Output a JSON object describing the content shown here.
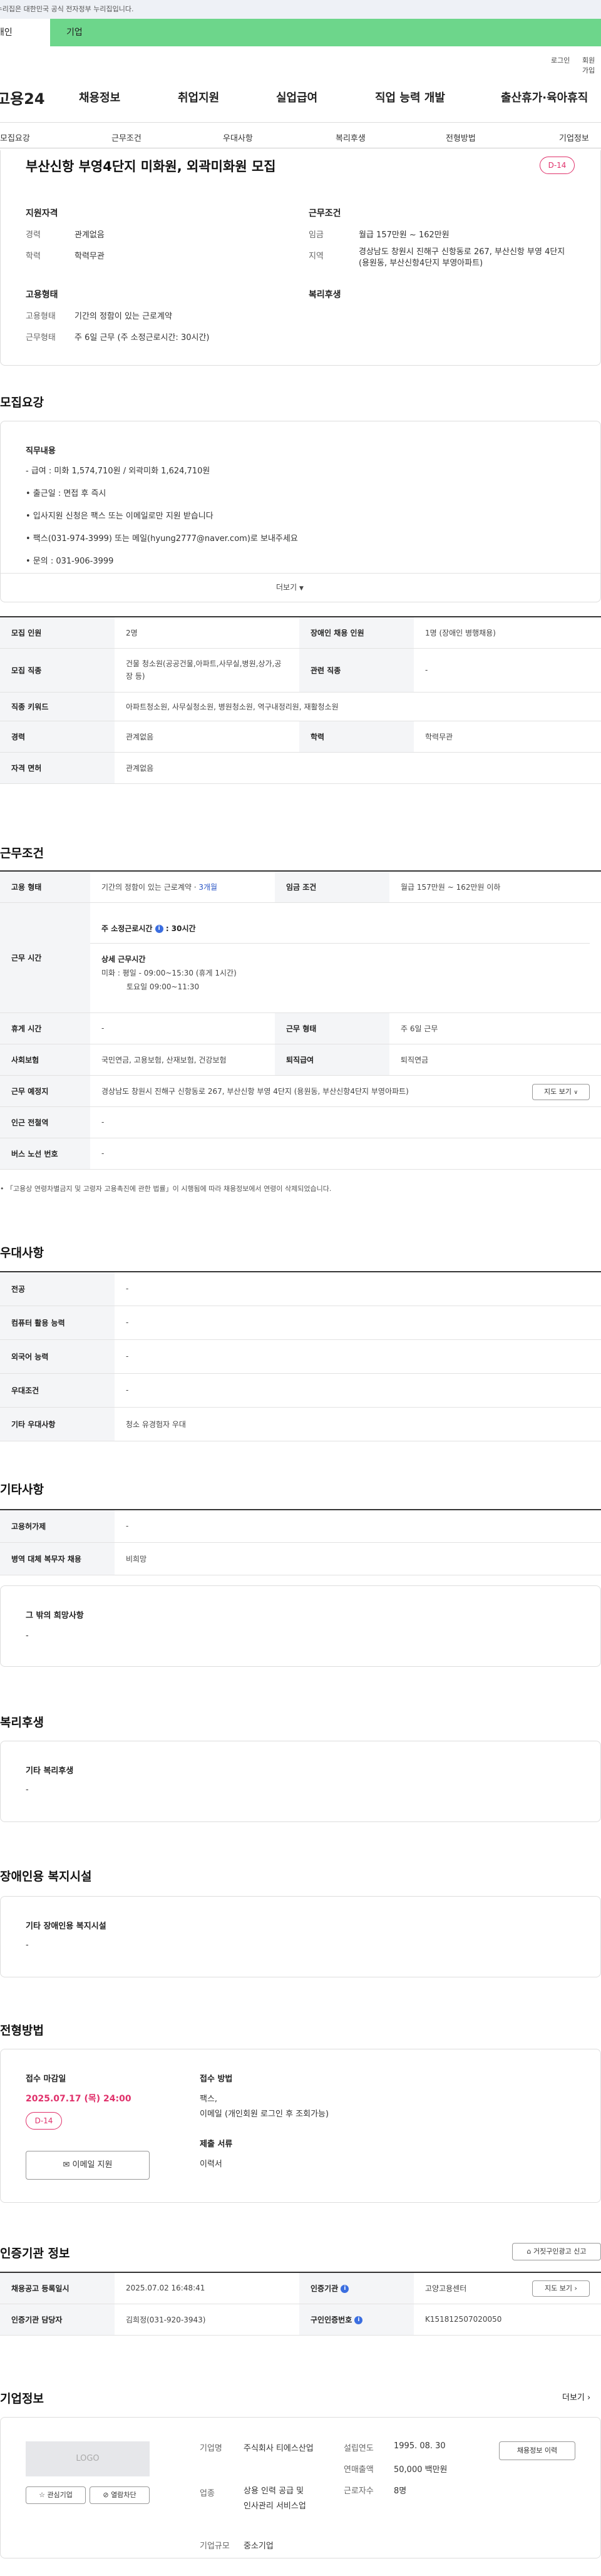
{
  "gov_banner": "이 누리집은 대한민국 공식 전자정부 누리집입니다.",
  "top_tabs": {
    "personal": "개인",
    "enterprise": "기업"
  },
  "util": {
    "login": "로그인",
    "join": "회원가입"
  },
  "logo": "고용24",
  "gnb": [
    "채용정보",
    "취업지원",
    "실업급여",
    "직업 능력 개발",
    "출산휴가·육아휴직"
  ],
  "subnav": [
    "모집요강",
    "근무조건",
    "우대사항",
    "복리후생",
    "전형방법",
    "기업정보"
  ],
  "summary": {
    "title": "부산신항 부영4단지 미화원, 외곽미화원 모집",
    "dday": "D-14",
    "qual_title": "지원자격",
    "career_label": "경력",
    "career": "관계없음",
    "edu_label": "학력",
    "edu": "학력무관",
    "cond_title": "근무조건",
    "wage_label": "임금",
    "wage": "월급 157만원 ~ 162만원",
    "area_label": "지역",
    "area": "경상남도 창원시 진해구 신항동로 267, 부산신항 부영 4단지 (용원동, 부산신항4단지 부영아파트)",
    "emp_title": "고용형태",
    "emptype_label": "고용형태",
    "emptype": "기간의 정함이 있는 근로계약",
    "worktype_label": "근무형태",
    "worktype": "주 6일 근무 (주 소정근로시간: 30시간)",
    "welfare_title": "복리후생"
  },
  "recruit": {
    "heading": "모집요강",
    "duty_title": "직무내용",
    "lines": [
      "- 급여 : 미화 1,574,710원 / 외곽미화 1,624,710원",
      "• 출근일 : 면접 후 즉시",
      "• 입사지원 신청은 팩스 또는 이메일로만 지원 받습니다",
      "• 팩스(031-974-3999) 또는 메일(hyung2777@naver.com)로 보내주세요",
      "• 문의 : 031-906-3999"
    ],
    "more": "더보기"
  },
  "recruit_table": {
    "count_label": "모집 인원",
    "count": "2명",
    "disabled_label": "장애인 채용 인원",
    "disabled": "1명 (장애인 병행채용)",
    "job_label": "모집 직종",
    "job": "건물 청소원(공공건물,아파트,사무실,병원,상가,공장 등)",
    "related_label": "관련 직종",
    "related": "-",
    "keyword_label": "직종 키워드",
    "keyword": "아파트청소원, 사무실청소원, 병원청소원, 역구내정리원, 재활청소원",
    "career_label": "경력",
    "career": "관계없음",
    "edu_label": "학력",
    "edu": "학력무관",
    "license_label": "자격 면허",
    "license": "관계없음"
  },
  "work": {
    "heading": "근무조건",
    "type_label": "고용 형태",
    "type": "기간의 정함이 있는 근로계약 · ",
    "type_period": "3개월",
    "wage_label": "임금 조건",
    "wage": "월급 157만원 ~ 162만원 이하",
    "hours_label": "근무 시간",
    "weekly": "주 소정근로시간 ",
    "weekly_val": "30시간",
    "detail_title": "상세 근무시간",
    "detail1": "미화 : 평일 - 09:00~15:30 (휴게 1시간)",
    "detail2": "토요일 09:00~11:30",
    "rest_label": "휴게 시간",
    "rest": "-",
    "form_label": "근무 형태",
    "form": "주 6일 근무",
    "insurance_label": "사회보험",
    "insurance": "국민연금, 고용보험, 산재보험, 건강보험",
    "severance_label": "퇴직급여",
    "severance": "퇴직연금",
    "place_label": "근무 예정지",
    "place": "경상남도 창원시 진해구 신항동로 267, 부산신항 부영 4단지 (용원동, 부산신항4단지 부영아파트)",
    "map_btn": "지도 보기",
    "subway_label": "인근 전철역",
    "subway": "-",
    "bus_label": "버스 노선 번호",
    "bus": "-",
    "note": "「고용상 연령차별금지 및 고령자 고용촉진에 관한 법률」이 시행됨에 따라 채용정보에서 연령이 삭제되었습니다."
  },
  "pref": {
    "heading": "우대사항",
    "rows": [
      {
        "label": "전공",
        "value": "-"
      },
      {
        "label": "컴퓨터 활용 능력",
        "value": "-"
      },
      {
        "label": "외국어 능력",
        "value": "-"
      },
      {
        "label": "우대조건",
        "value": "-"
      },
      {
        "label": "기타 우대사항",
        "value": "청소 유경험자 우대"
      }
    ]
  },
  "etc": {
    "heading": "기타사항",
    "rows": [
      {
        "label": "고용허가제",
        "value": "-"
      },
      {
        "label": "병역 대체 복무자 채용",
        "value": "비희망"
      }
    ],
    "other_title": "그 밖의 희망사항",
    "other": "-"
  },
  "welfare": {
    "heading": "복리후생",
    "title": "기타 복리후생",
    "value": "-"
  },
  "facility": {
    "heading": "장애인용 복지시설",
    "title": "기타 장애인용 복지시설",
    "value": "-"
  },
  "screening": {
    "heading": "전형방법",
    "deadline_title": "접수 마감일",
    "deadline": "2025.07.17 (목) 24:00",
    "dday": "D-14",
    "email_btn": "이메일 지원",
    "method_title": "접수 방법",
    "method1": "팩스,",
    "method2": "이메일 (개인회원 로그인 후 조회가능)",
    "docs_title": "제출 서류",
    "docs": "이력서"
  },
  "cert": {
    "heading": "인증기관 정보",
    "report_btn": "거짓구인광고 신고",
    "reg_label": "채용공고 등록일시",
    "reg": "2025.07.02 16:48:41",
    "org_label": "인증기관",
    "org": "고양고용센터",
    "map_btn": "지도 보기",
    "manager_label": "인증기관 담당자",
    "manager": "김희정(031-920-3943)",
    "num_label": "구인인증번호",
    "num": "K151812507020050"
  },
  "company": {
    "heading": "기업정보",
    "more": "더보기",
    "logo": "LOGO",
    "fav_btn": "관심기업",
    "block_btn": "열람차단",
    "name_label": "기업명",
    "name": "주식회사 티에스산업",
    "biz_label": "업종",
    "biz": "상용 인력 공급 및 인사관리 서비스업",
    "size_label": "기업규모",
    "size": "중소기업",
    "founded_label": "설립연도",
    "founded": "1995. 08. 30",
    "sales_label": "연매출액",
    "sales": "50,000 백만원",
    "emp_label": "근로자수",
    "emp": "8명",
    "jobs_btn": "채용정보 이력"
  }
}
